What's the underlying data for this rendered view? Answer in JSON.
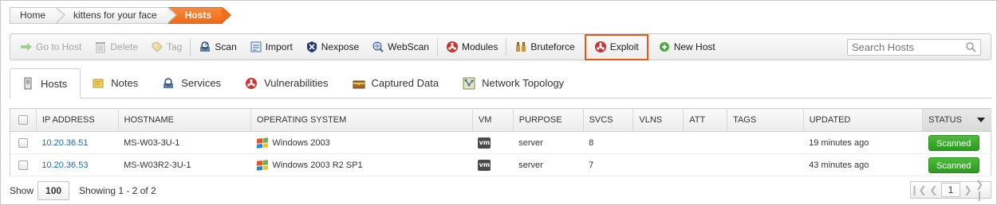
{
  "breadcrumb": {
    "items": [
      "Home",
      "kittens for your face",
      "Hosts"
    ]
  },
  "toolbar": {
    "go_to_host": "Go to Host",
    "delete": "Delete",
    "tag": "Tag",
    "scan": "Scan",
    "import": "Import",
    "nexpose": "Nexpose",
    "webscan": "WebScan",
    "modules": "Modules",
    "bruteforce": "Bruteforce",
    "exploit": "Exploit",
    "new_host": "New Host",
    "search_placeholder": "Search Hosts"
  },
  "tabs": [
    "Hosts",
    "Notes",
    "Services",
    "Vulnerabilities",
    "Captured Data",
    "Network Topology"
  ],
  "table": {
    "headers": [
      "IP ADDRESS",
      "HOSTNAME",
      "OPERATING SYSTEM",
      "VM",
      "PURPOSE",
      "SVCS",
      "VLNS",
      "ATT",
      "TAGS",
      "UPDATED",
      "STATUS"
    ],
    "rows": [
      {
        "ip": "10.20.36.51",
        "hostname": "MS-W03-3U-1",
        "os": "Windows 2003",
        "vm": "vm",
        "purpose": "server",
        "svcs": "8",
        "vlns": "",
        "att": "",
        "tags": "",
        "updated": "19 minutes ago",
        "status": "Scanned"
      },
      {
        "ip": "10.20.36.53",
        "hostname": "MS-W03R2-3U-1",
        "os": "Windows 2003 R2 SP1",
        "vm": "vm",
        "purpose": "server",
        "svcs": "7",
        "vlns": "",
        "att": "",
        "tags": "",
        "updated": "43 minutes ago",
        "status": "Scanned"
      }
    ]
  },
  "footer": {
    "show_label": "Show",
    "page_size": "100",
    "showing": "Showing 1 - 2 of 2",
    "current_page": "1"
  },
  "colors": {
    "accent_orange": "#ef6a17",
    "status_green": "#36a528",
    "link_blue": "#1c6aa5"
  }
}
